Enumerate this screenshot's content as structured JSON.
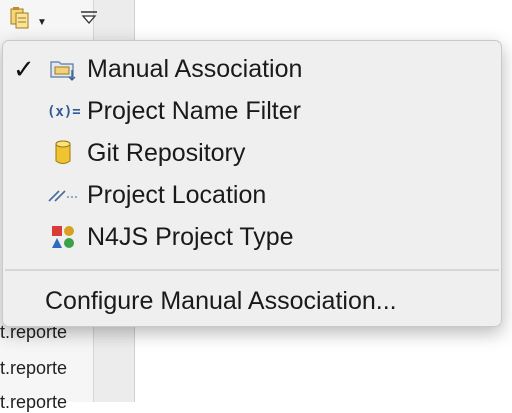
{
  "toolbar": {
    "filter_button_icon": "project-filter-icon",
    "dropdown_icon": "chevron-down-icon",
    "view_menu_icon": "view-menu-triangle-icon"
  },
  "background": {
    "rows": [
      {
        "text": "t.reporte"
      },
      {
        "text": "t.reporte"
      },
      {
        "text": "t.reporte"
      }
    ]
  },
  "menu": {
    "items": [
      {
        "label": "Manual Association",
        "checked": true,
        "icon": "folder-association-icon"
      },
      {
        "label": "Project Name Filter",
        "checked": false,
        "icon": "variable-filter-icon"
      },
      {
        "label": "Git Repository",
        "checked": false,
        "icon": "git-repository-icon"
      },
      {
        "label": "Project Location",
        "checked": false,
        "icon": "location-path-icon"
      },
      {
        "label": "N4JS Project Type",
        "checked": false,
        "icon": "project-type-shapes-icon"
      }
    ],
    "configure_label": "Configure Manual Association...",
    "check_glyph": "✓"
  },
  "colors": {
    "menu_background": "#efefef",
    "menu_border": "#c9c9c9",
    "text": "#1a1a1a",
    "separator": "#d6d6d6"
  }
}
